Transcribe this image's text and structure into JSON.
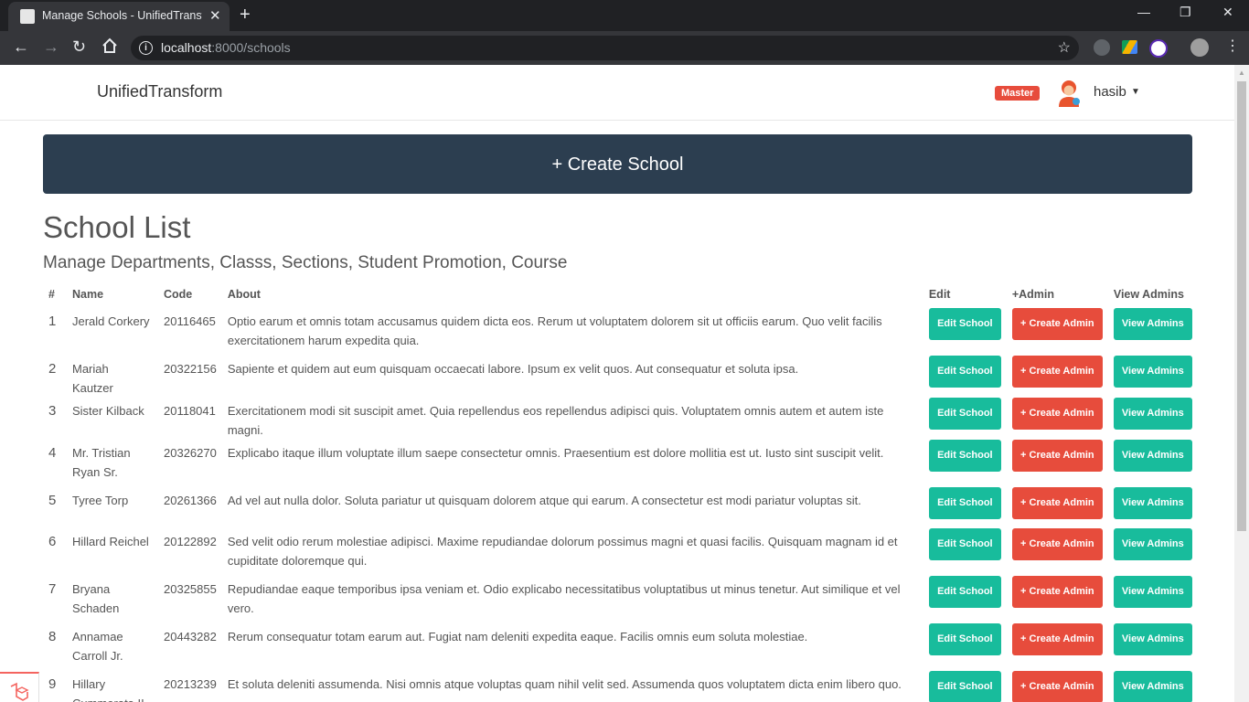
{
  "browser": {
    "tab_title": "Manage Schools - UnifiedTransform",
    "tab_close": "✕",
    "new_tab": "+",
    "url_host": "localhost",
    "url_path": ":8000/schools",
    "window_controls": [
      "—",
      "❐",
      "✕"
    ]
  },
  "navbar": {
    "brand": "UnifiedTransform",
    "role_badge": "Master",
    "username": "hasib"
  },
  "create_button": "+ Create School",
  "heading": "School List",
  "subheading": "Manage Departments, Classs, Sections, Student Promotion, Course",
  "table": {
    "headers": [
      "#",
      "Name",
      "Code",
      "About",
      "Edit",
      "+Admin",
      "View Admins"
    ],
    "buttons": {
      "edit": "Edit School",
      "create_admin": "+ Create Admin",
      "view": "View Admins"
    },
    "rows": [
      {
        "idx": "1",
        "name": "Jerald Corkery",
        "code": "20116465",
        "about": "Optio earum et omnis totam accusamus quidem dicta eos. Rerum ut voluptatem dolorem sit ut officiis earum. Quo velit facilis exercitationem harum expedita quia."
      },
      {
        "idx": "2",
        "name": "Mariah Kautzer",
        "code": "20322156",
        "about": "Sapiente et quidem aut eum quisquam occaecati labore. Ipsum ex velit quos. Aut consequatur et soluta ipsa."
      },
      {
        "idx": "3",
        "name": "Sister Kilback",
        "code": "20118041",
        "about": "Exercitationem modi sit suscipit amet. Quia repellendus eos repellendus adipisci quis. Voluptatem omnis autem et autem iste magni."
      },
      {
        "idx": "4",
        "name": "Mr. Tristian Ryan Sr.",
        "code": "20326270",
        "about": "Explicabo itaque illum voluptate illum saepe consectetur omnis. Praesentium est dolore mollitia est ut. Iusto sint suscipit velit."
      },
      {
        "idx": "5",
        "name": "Tyree Torp",
        "code": "20261366",
        "about": "Ad vel aut nulla dolor. Soluta pariatur ut quisquam dolorem atque qui earum. A consectetur est modi pariatur voluptas sit."
      },
      {
        "idx": "6",
        "name": "Hillard Reichel",
        "code": "20122892",
        "about": "Sed velit odio rerum molestiae adipisci. Maxime repudiandae dolorum possimus magni et quasi facilis. Quisquam magnam id et cupiditate doloremque qui."
      },
      {
        "idx": "7",
        "name": "Bryana Schaden",
        "code": "20325855",
        "about": "Repudiandae eaque temporibus ipsa veniam et. Odio explicabo necessitatibus voluptatibus ut minus tenetur. Aut similique et vel vero."
      },
      {
        "idx": "8",
        "name": "Annamae Carroll Jr.",
        "code": "20443282",
        "about": "Rerum consequatur totam earum aut. Fugiat nam deleniti expedita eaque. Facilis omnis eum soluta molestiae."
      },
      {
        "idx": "9",
        "name": "Hillary Cummerata II",
        "code": "20213239",
        "about": "Et soluta deleniti assumenda. Nisi omnis atque voluptas quam nihil velit sed. Assumenda quos voluptatem dicta enim libero quo."
      }
    ]
  },
  "colors": {
    "navy": "#2c3e50",
    "green": "#18bc9c",
    "red": "#e74c3c"
  }
}
